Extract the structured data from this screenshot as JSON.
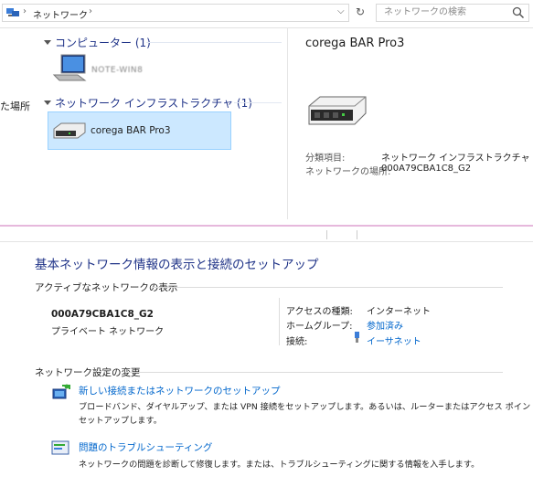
{
  "address": {
    "crumb": "ネットワーク",
    "search_placeholder": "ネットワークの検索"
  },
  "nav": {
    "partial_label": "た場所"
  },
  "groups": [
    {
      "header": "コンピューター (1)",
      "items": [
        {
          "label": "NOTE-WIN8"
        }
      ]
    },
    {
      "header": "ネットワーク インフラストラクチャ (1)",
      "items": [
        {
          "label": "corega BAR Pro3"
        }
      ]
    }
  ],
  "details": {
    "title": "corega BAR Pro3",
    "rows": [
      {
        "label": "分類項目:",
        "value": "ネットワーク インフラストラクチャ"
      },
      {
        "label": "ネットワークの場所:",
        "value": "000A79CBA1C8_G2"
      }
    ]
  },
  "network_center": {
    "title": "基本ネットワーク情報の表示と接続のセットアップ",
    "active_section": "アクティブなネットワークの表示",
    "network_name": "000A79CBA1C8_G2",
    "network_type": "プライベート ネットワーク",
    "access_type_label": "アクセスの種類:",
    "access_type_value": "インターネット",
    "homegroup_label": "ホームグループ:",
    "homegroup_value": "参加済み",
    "connection_label": "接続:",
    "connection_value": "イーサネット",
    "change_section": "ネットワーク設定の変更",
    "tasks": [
      {
        "title": "新しい接続またはネットワークのセットアップ",
        "desc1": "ブロードバンド、ダイヤルアップ、または VPN 接続をセットアップします。あるいは、ルーターまたはアクセス ポイントを",
        "desc2": "セットアップします。"
      },
      {
        "title": "問題のトラブルシューティング",
        "desc1": "ネットワークの問題を診断して修復します。または、トラブルシューティングに関する情報を入手します。",
        "desc2": ""
      }
    ]
  }
}
